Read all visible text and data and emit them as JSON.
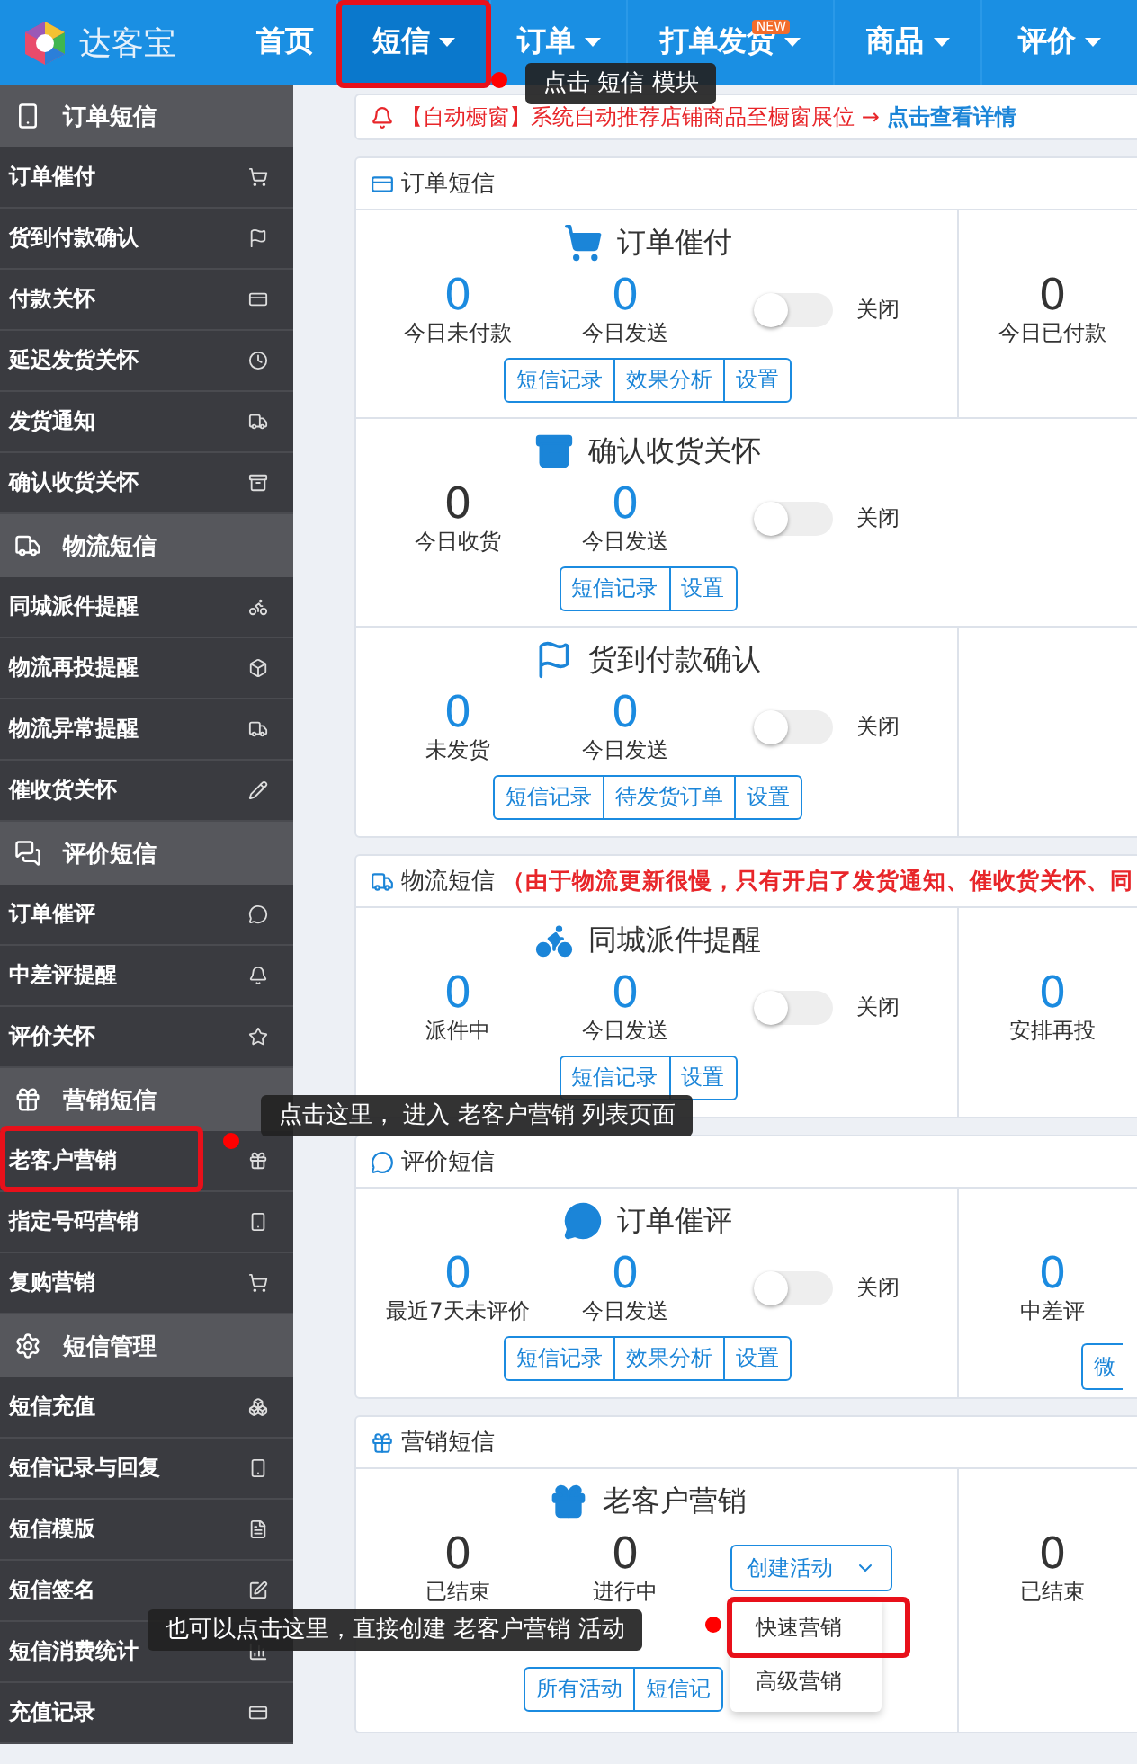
{
  "nav": {
    "logo": "达客宝",
    "items": [
      {
        "label": "首页",
        "selected": false,
        "dropdown": false
      },
      {
        "label": "短信",
        "selected": true,
        "dropdown": true
      },
      {
        "label": "订单",
        "selected": false,
        "dropdown": true
      },
      {
        "label": "打单发货",
        "selected": false,
        "dropdown": true,
        "badge": "NEW"
      },
      {
        "label": "商品",
        "selected": false,
        "dropdown": true
      },
      {
        "label": "评价",
        "selected": false,
        "dropdown": true
      }
    ]
  },
  "sidebar": {
    "groups": [
      {
        "title": "订单短信",
        "items": [
          {
            "label": "订单催付",
            "selected": false
          },
          {
            "label": "货到付款确认",
            "selected": false
          },
          {
            "label": "付款关怀",
            "selected": false
          },
          {
            "label": "延迟发货关怀",
            "selected": false
          },
          {
            "label": "发货通知",
            "selected": false
          },
          {
            "label": "确认收货关怀",
            "selected": false
          }
        ]
      },
      {
        "title": "物流短信",
        "items": [
          {
            "label": "同城派件提醒",
            "selected": false
          },
          {
            "label": "物流再投提醒",
            "selected": false
          },
          {
            "label": "物流异常提醒",
            "selected": false
          },
          {
            "label": "催收货关怀",
            "selected": false
          }
        ]
      },
      {
        "title": "评价短信",
        "items": [
          {
            "label": "订单催评",
            "selected": false
          },
          {
            "label": "中差评提醒",
            "selected": false
          },
          {
            "label": "评价关怀",
            "selected": false
          }
        ]
      },
      {
        "title": "营销短信",
        "items": [
          {
            "label": "老客户营销",
            "selected": false
          },
          {
            "label": "指定号码营销",
            "selected": false
          },
          {
            "label": "复购营销",
            "selected": false
          }
        ]
      },
      {
        "title": "短信管理",
        "items": [
          {
            "label": "短信充值",
            "selected": false
          },
          {
            "label": "短信记录与回复",
            "selected": false
          },
          {
            "label": "短信模版",
            "selected": false
          },
          {
            "label": "短信签名",
            "selected": false
          },
          {
            "label": "短信消费统计",
            "selected": false
          },
          {
            "label": "充值记录",
            "selected": false
          }
        ]
      }
    ]
  },
  "notice": {
    "text": "【自动橱窗】系统自动推荐店铺商品至橱窗展位 →",
    "link": "点击查看详情"
  },
  "cards": [
    {
      "title": "订单短信",
      "rows": [
        {
          "title": "订单催付",
          "divider": true,
          "stats": [
            {
              "value": "0",
              "label": "今日未付款",
              "highlight": true
            },
            {
              "value": "0",
              "label": "今日发送",
              "highlight": true
            }
          ],
          "toggle": {
            "on": false,
            "label": "关闭"
          },
          "buttons": [
            "短信记录",
            "效果分析",
            "设置"
          ],
          "side": {
            "stats": [
              {
                "value": "0",
                "label": "今日已付款",
                "highlight": false
              }
            ]
          }
        },
        {
          "title": "确认收货关怀",
          "divider": false,
          "stats": [
            {
              "value": "0",
              "label": "今日收货",
              "highlight": false
            },
            {
              "value": "0",
              "label": "今日发送",
              "highlight": true
            }
          ],
          "toggle": {
            "on": false,
            "label": "关闭"
          },
          "buttons": [
            "短信记录",
            "设置"
          ]
        },
        {
          "title": "货到付款确认",
          "divider": true,
          "stats": [
            {
              "value": "0",
              "label": "未发货",
              "highlight": true
            },
            {
              "value": "0",
              "label": "今日发送",
              "highlight": true
            }
          ],
          "toggle": {
            "on": false,
            "label": "关闭"
          },
          "buttons": [
            "短信记录",
            "待发货订单",
            "设置"
          ]
        }
      ]
    },
    {
      "title": "物流短信",
      "note": "（由于物流更新很慢，只有开启了发货通知、催收货关怀、同",
      "rows": [
        {
          "title": "同城派件提醒",
          "divider": true,
          "stats": [
            {
              "value": "0",
              "label": "派件中",
              "highlight": true
            },
            {
              "value": "0",
              "label": "今日发送",
              "highlight": true
            }
          ],
          "toggle": {
            "on": false,
            "label": "关闭"
          },
          "buttons": [
            "短信记录",
            "设置"
          ],
          "side": {
            "stats": [
              {
                "value": "0",
                "label": "安排再投",
                "highlight": true
              }
            ]
          }
        }
      ]
    },
    {
      "title": "评价短信",
      "rows": [
        {
          "title": "订单催评",
          "divider": true,
          "stats": [
            {
              "value": "0",
              "label": "最近7天未评价",
              "highlight": true
            },
            {
              "value": "0",
              "label": "今日发送",
              "highlight": true
            }
          ],
          "toggle": {
            "on": false,
            "label": "关闭"
          },
          "buttons": [
            "短信记录",
            "效果分析",
            "设置"
          ],
          "side": {
            "stats": [
              {
                "value": "0",
                "label": "中差评",
                "highlight": true
              }
            ],
            "buttons": [
              "微"
            ]
          }
        }
      ]
    },
    {
      "title": "营销短信",
      "rows": [
        {
          "title": "老客户营销",
          "divider": true,
          "stats": [
            {
              "value": "0",
              "label": "已结束",
              "highlight": false
            },
            {
              "value": "0",
              "label": "进行中",
              "highlight": false
            }
          ],
          "menu": {
            "label": "创建活动",
            "expanded": true,
            "items": [
              "快速营销",
              "高级营销"
            ]
          },
          "buttons": [
            "所有活动",
            "短信记"
          ],
          "side": {
            "stats": [
              {
                "value": "0",
                "label": "已结束",
                "highlight": false
              }
            ]
          }
        }
      ]
    }
  ],
  "tooltips": [
    "点击 短信 模块",
    "点击这里， 进入 老客户营销 列表页面",
    "也可以点击这里，直接创建 老客户营销 活动"
  ]
}
